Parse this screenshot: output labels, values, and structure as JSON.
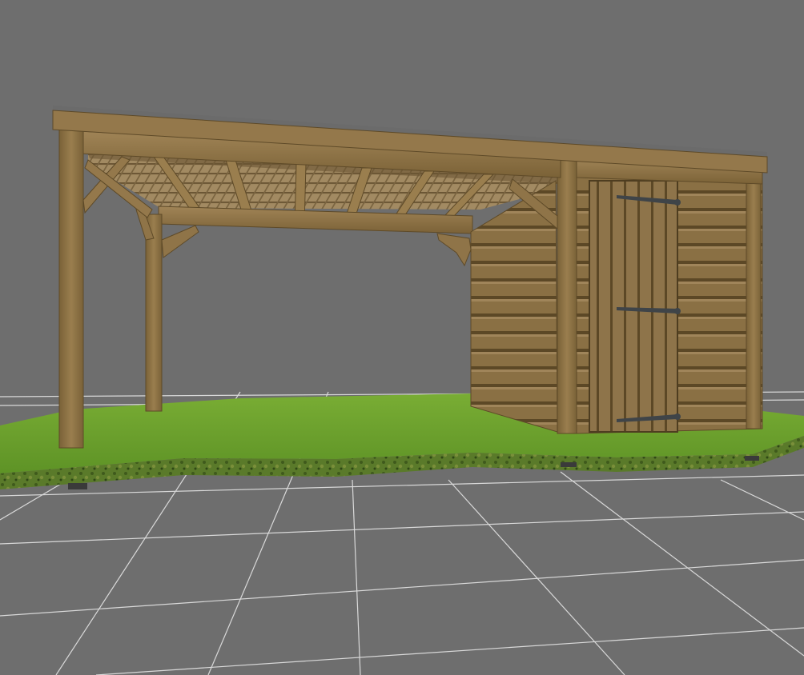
{
  "viewport": {
    "background_color": "#6e6e6e",
    "grid_line_color": "#d9d9d9"
  },
  "model": {
    "wood_color": "#8b7346",
    "wood_dark_color": "#5e4a28",
    "wood_light_color": "#a5895a",
    "roof_edge_color": "#6b6b6b",
    "grass_color": "#6fa42e",
    "grass_edge_color": "#4e6b24",
    "hinge_color": "#3f4448"
  }
}
